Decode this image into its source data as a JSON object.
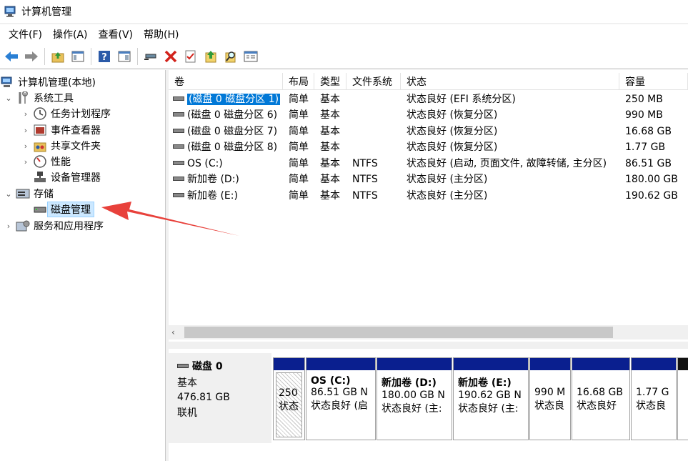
{
  "window": {
    "title": "计算机管理"
  },
  "menu": [
    "文件(F)",
    "操作(A)",
    "查看(V)",
    "帮助(H)"
  ],
  "toolbar": {
    "icons": [
      "back-icon",
      "forward-icon",
      "up-folder-icon",
      "show-hide-tree-icon",
      "help-icon",
      "show-action-pane-icon",
      "connect-icon",
      "delete-icon",
      "check-icon",
      "upload-icon",
      "search-icon",
      "properties-icon"
    ]
  },
  "tree": {
    "root": "计算机管理(本地)",
    "system_tools": "系统工具",
    "task_scheduler": "任务计划程序",
    "event_viewer": "事件查看器",
    "shared_folders": "共享文件夹",
    "performance": "性能",
    "device_manager": "设备管理器",
    "storage": "存储",
    "disk_management": "磁盘管理",
    "services": "服务和应用程序"
  },
  "volume_table": {
    "headers": [
      "卷",
      "布局",
      "类型",
      "文件系统",
      "状态",
      "容量"
    ],
    "rows": [
      {
        "volume": "(磁盘 0 磁盘分区 1)",
        "layout": "简单",
        "type": "基本",
        "fs": "",
        "status": "状态良好 (EFI 系统分区)",
        "capacity": "250 MB"
      },
      {
        "volume": "(磁盘 0 磁盘分区 6)",
        "layout": "简单",
        "type": "基本",
        "fs": "",
        "status": "状态良好 (恢复分区)",
        "capacity": "990 MB"
      },
      {
        "volume": "(磁盘 0 磁盘分区 7)",
        "layout": "简单",
        "type": "基本",
        "fs": "",
        "status": "状态良好 (恢复分区)",
        "capacity": "16.68 GB"
      },
      {
        "volume": "(磁盘 0 磁盘分区 8)",
        "layout": "简单",
        "type": "基本",
        "fs": "",
        "status": "状态良好 (恢复分区)",
        "capacity": "1.77 GB"
      },
      {
        "volume": "OS (C:)",
        "layout": "简单",
        "type": "基本",
        "fs": "NTFS",
        "status": "状态良好 (启动, 页面文件, 故障转储, 主分区)",
        "capacity": "86.51 GB"
      },
      {
        "volume": "新加卷 (D:)",
        "layout": "简单",
        "type": "基本",
        "fs": "NTFS",
        "status": "状态良好 (主分区)",
        "capacity": "180.00 GB"
      },
      {
        "volume": "新加卷 (E:)",
        "layout": "简单",
        "type": "基本",
        "fs": "NTFS",
        "status": "状态良好 (主分区)",
        "capacity": "190.62 GB"
      }
    ]
  },
  "disk": {
    "name": "磁盘 0",
    "kind": "基本",
    "size": "476.81 GB",
    "state": "联机",
    "partitions": [
      {
        "name": "",
        "size": "250",
        "status": "状态"
      },
      {
        "name": "OS  (C:)",
        "size": "86.51 GB N",
        "status": "状态良好 (启"
      },
      {
        "name": "新加卷  (D:)",
        "size": "180.00 GB N",
        "status": "状态良好 (主:"
      },
      {
        "name": "新加卷  (E:)",
        "size": "190.62 GB N",
        "status": "状态良好 (主:"
      },
      {
        "name": "",
        "size": "990 M",
        "status": "状态良"
      },
      {
        "name": "",
        "size": "16.68 GB",
        "status": "状态良好"
      },
      {
        "name": "",
        "size": "1.77 G",
        "status": "状态良"
      },
      {
        "name": "",
        "size": "",
        "status": ""
      }
    ]
  },
  "colors": {
    "partition_bar": "#0a1f8f",
    "selection": "#0078d7",
    "annotation_arrow": "#e8413b"
  }
}
